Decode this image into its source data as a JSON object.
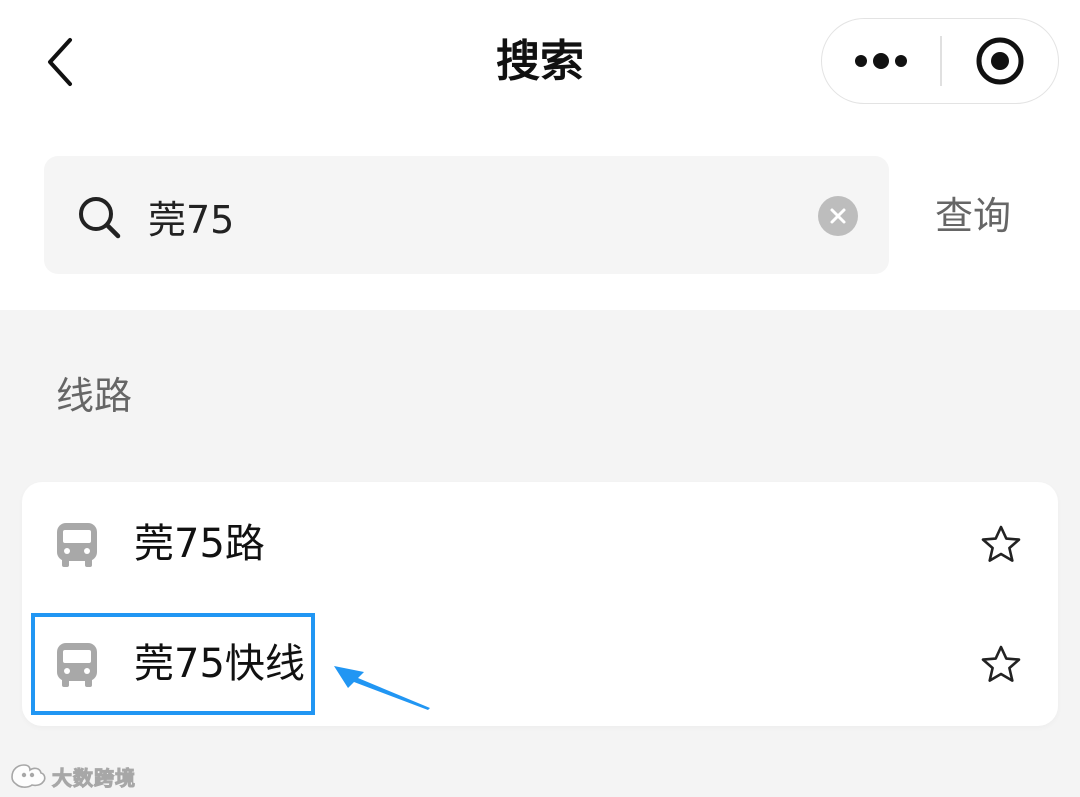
{
  "nav": {
    "title": "搜索",
    "back_icon": "chevron-left-icon",
    "more_icon": "more-dots-icon",
    "close_icon": "target-close-icon"
  },
  "search": {
    "value": "莞75",
    "icon": "search-icon",
    "clear_icon": "clear-circle-icon",
    "submit_label": "查询"
  },
  "results": {
    "section_title": "线路",
    "routes": [
      {
        "name": "莞75路",
        "icon": "bus-icon",
        "favorite_icon": "star-outline-icon"
      },
      {
        "name": "莞75快线",
        "icon": "bus-icon",
        "favorite_icon": "star-outline-icon"
      }
    ]
  },
  "annotation": {
    "highlight_color": "#2196f3",
    "highlighted_route": "莞75快线"
  },
  "watermark": {
    "text": "大数跨境"
  },
  "colors": {
    "page_background": "#f4f4f4",
    "header_background": "#ffffff",
    "search_background": "#f5f5f5",
    "muted_text": "#666666",
    "icon_gray": "#a8a8a8",
    "accent_blue": "#2196f3"
  }
}
